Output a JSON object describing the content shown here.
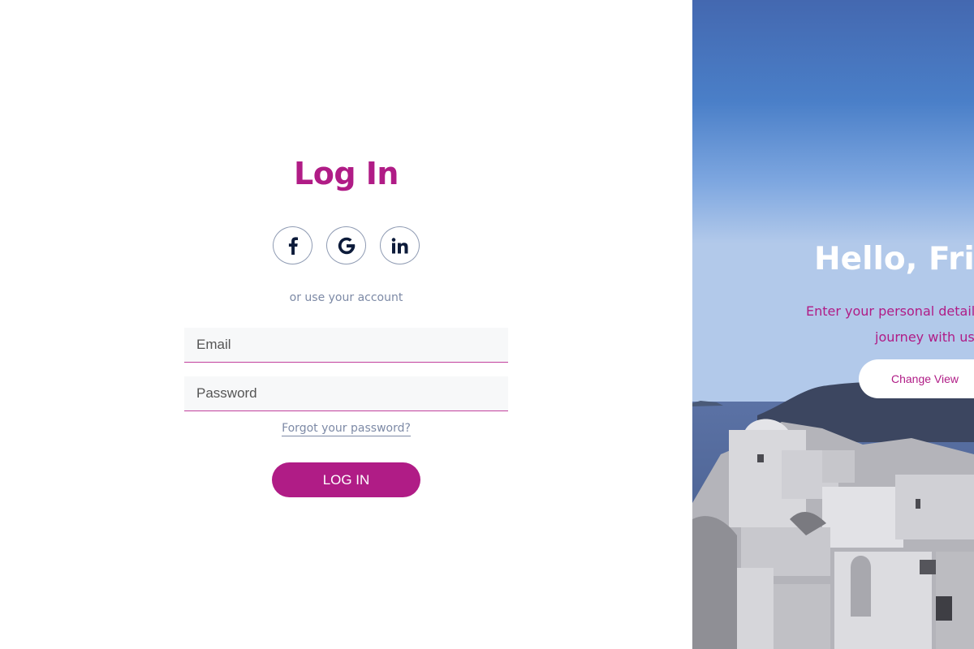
{
  "login": {
    "title": "Log In",
    "social": [
      {
        "label": "f",
        "icon": "facebook-icon"
      },
      {
        "label": "G",
        "icon": "google-icon"
      },
      {
        "label": "in",
        "icon": "linkedin-icon"
      }
    ],
    "alt_text": "or use your account",
    "email_placeholder": "Email",
    "password_placeholder": "Password",
    "forgot_label": "Forgot your password?",
    "submit_label": "LOG IN"
  },
  "overlay": {
    "title": "Hello, Friend!",
    "text_line1": "Enter your personal details and start",
    "text_line2": "journey with us",
    "button_label": "Change View"
  },
  "colors": {
    "accent": "#b01c86",
    "muted": "#7d8aa6",
    "field_bg": "#f7f8f9"
  }
}
